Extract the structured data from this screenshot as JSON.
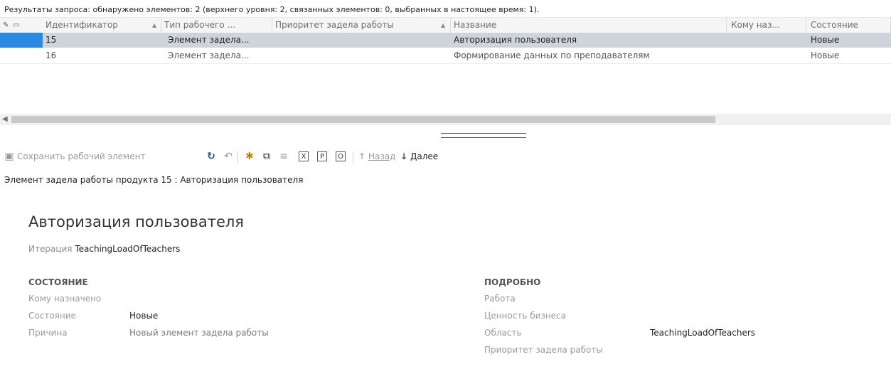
{
  "summary": "Результаты запроса: обнаружено элементов: 2 (верхнего уровня: 2, связанных элементов: 0, выбранных в настоящее время: 1).",
  "grid": {
    "columns": [
      "Идентификатор",
      "Тип рабочего ...",
      "Приоритет задела работы",
      "Название",
      "Кому наз...",
      "Состояние"
    ],
    "rows": [
      [
        "15",
        "Элемент задела...",
        "",
        "Авторизация пользователя",
        "",
        "Новые"
      ],
      [
        "16",
        "Элемент задела...",
        "",
        "Формирование данных по преподавателям",
        "",
        "Новые"
      ]
    ]
  },
  "toolbar": {
    "save_label": "Сохранить рабочий элемент",
    "back_label": "Назад",
    "next_label": "Далее"
  },
  "breadcrumb": "Элемент задела работы продукта 15 : Авторизация пользователя",
  "form": {
    "title": "Авторизация пользователя",
    "iteration_label": "Итерация",
    "iteration_value": "TeachingLoadOfTeachers",
    "status": {
      "heading": "СОСТОЯНИЕ",
      "assigned_label": "Кому назначено",
      "assigned_value": "",
      "state_label": "Состояние",
      "state_value": "Новые",
      "reason_label": "Причина",
      "reason_value": "Новый элемент задела работы"
    },
    "details": {
      "heading": "ПОДРОБНО",
      "work_label": "Работа",
      "business_value_label": "Ценность бизнеса",
      "area_label": "Область",
      "area_value": "TeachingLoadOfTeachers",
      "priority_label": "Приоритет задела работы"
    }
  },
  "colors": {
    "selection": "#cfd3da",
    "selection_marker": "#2b8ae0",
    "header_bg": "#f5f5f5"
  },
  "icons": [
    "pencil-icon",
    "link-icon",
    "save-icon",
    "refresh-icon",
    "undo-icon",
    "assign-icon",
    "new-window-icon",
    "clear-icon",
    "excel-icon",
    "project-icon",
    "outlook-icon",
    "back-arrow-icon",
    "next-arrow-icon"
  ]
}
